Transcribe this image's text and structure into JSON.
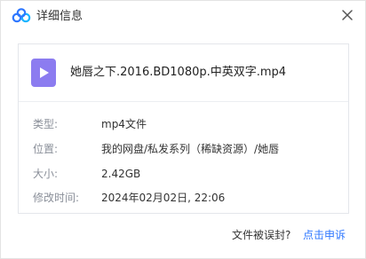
{
  "dialog": {
    "title": "详细信息",
    "logo_icon": "baidu-netdisk-cloud-icon",
    "close_icon": "close-icon"
  },
  "file": {
    "icon": "video-file-icon",
    "icon_color": "#8c7cf0",
    "name": "她唇之下.2016.BD1080p.中英双字.mp4"
  },
  "details": [
    {
      "label": "类型:",
      "value": "mp4文件"
    },
    {
      "label": "位置:",
      "value": "我的网盘/私发系列（稀缺资源）/她唇"
    },
    {
      "label": "大小:",
      "value": "2.42GB"
    },
    {
      "label": "修改时间:",
      "value": "2024年02月02日, 22:06"
    }
  ],
  "footer": {
    "question": "文件被误封?",
    "appeal_link": "点击申诉",
    "link_color": "#2e77ff"
  }
}
